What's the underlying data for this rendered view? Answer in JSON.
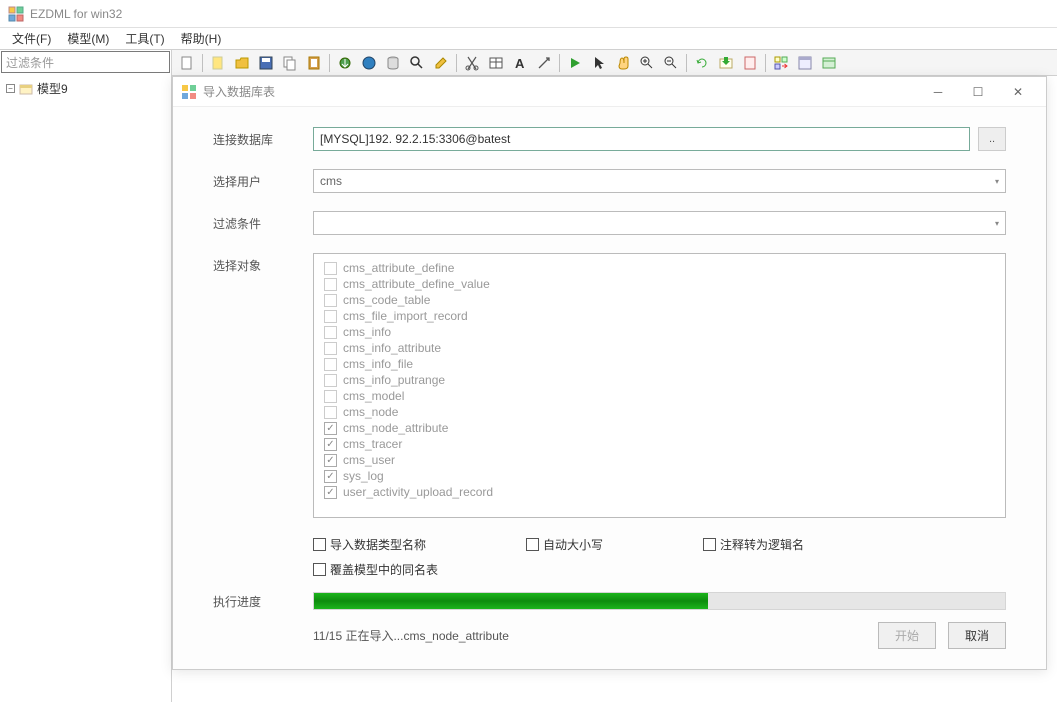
{
  "app": {
    "title": "EZDML for win32"
  },
  "menubar": {
    "file": "文件(F)",
    "model": "模型(M)",
    "tool": "工具(T)",
    "help": "帮助(H)"
  },
  "sidebar": {
    "filter_placeholder": "过滤条件",
    "model_node": "模型9"
  },
  "dialog": {
    "title": "导入数据库表",
    "labels": {
      "conn": "连接数据库",
      "user": "选择用户",
      "filter": "过滤条件",
      "objects": "选择对象",
      "progress": "执行进度"
    },
    "conn_value": "[MYSQL]192. 92.2.15:3306@batest",
    "conn_btn": "..",
    "user_value": "cms",
    "filter_value": "",
    "objects": [
      {
        "name": "cms_attribute_define",
        "checked": false
      },
      {
        "name": "cms_attribute_define_value",
        "checked": false
      },
      {
        "name": "cms_code_table",
        "checked": false
      },
      {
        "name": "cms_file_import_record",
        "checked": false
      },
      {
        "name": "cms_info",
        "checked": false
      },
      {
        "name": "cms_info_attribute",
        "checked": false
      },
      {
        "name": "cms_info_file",
        "checked": false
      },
      {
        "name": "cms_info_putrange",
        "checked": false
      },
      {
        "name": "cms_model",
        "checked": false
      },
      {
        "name": "cms_node",
        "checked": false
      },
      {
        "name": "cms_node_attribute",
        "checked": true
      },
      {
        "name": "cms_tracer",
        "checked": true
      },
      {
        "name": "cms_user",
        "checked": true
      },
      {
        "name": "sys_log",
        "checked": true
      },
      {
        "name": "user_activity_upload_record",
        "checked": true
      }
    ],
    "options": {
      "import_type_names": "导入数据类型名称",
      "auto_case": "自动大小写",
      "comment_to_logic": "注释转为逻辑名",
      "overwrite_same": "覆盖模型中的同名表"
    },
    "status_text": "11/15 正在导入...cms_node_attribute",
    "progress_percent": 57,
    "btn_start": "开始",
    "btn_cancel": "取消"
  }
}
